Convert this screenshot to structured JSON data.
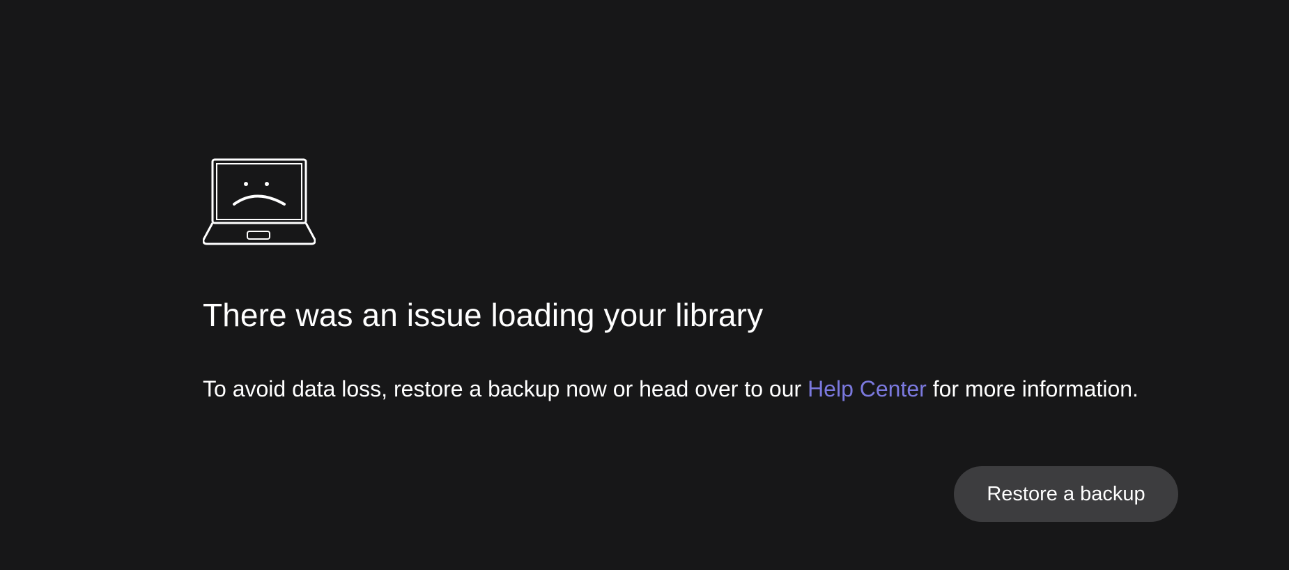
{
  "error": {
    "icon": "sad-laptop-icon",
    "title": "There was an issue loading your library",
    "description_before_link": "To avoid data loss, restore a backup now or head over to our ",
    "help_link_label": "Help Center",
    "description_after_link": " for more information."
  },
  "actions": {
    "restore_label": "Restore a backup"
  },
  "colors": {
    "background": "#171718",
    "text": "#ffffff",
    "link": "#7b79de",
    "button_background": "#3d3d3f"
  }
}
